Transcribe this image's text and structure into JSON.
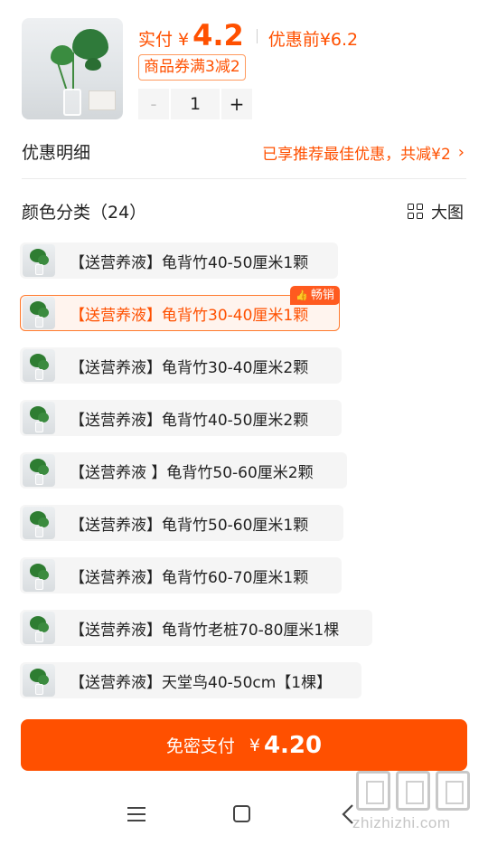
{
  "product": {
    "price_label": "实付",
    "currency": "¥",
    "price_value": "4.2",
    "original_label": "优惠前",
    "original_value": "¥6.2",
    "coupon": "商品券满3减2",
    "quantity": "1",
    "minus_symbol": "-",
    "plus_symbol": "+"
  },
  "discount": {
    "title": "优惠明细",
    "info": "已享推荐最佳优惠，共减¥2"
  },
  "variants": {
    "title": "颜色分类（24）",
    "big_view_label": "大图",
    "hot_badge": "畅销",
    "selected_index": 1,
    "items": [
      {
        "label": "【送营养液】龟背竹40-50厘米1颗"
      },
      {
        "label": "【送营养液】龟背竹30-40厘米1颗"
      },
      {
        "label": "【送营养液】龟背竹30-40厘米2颗"
      },
      {
        "label": "【送营养液】龟背竹40-50厘米2颗"
      },
      {
        "label": "【送营养液 】龟背竹50-60厘米2颗"
      },
      {
        "label": "【送营养液】龟背竹50-60厘米1颗"
      },
      {
        "label": "【送营养液】龟背竹60-70厘米1颗"
      },
      {
        "label": "【送营养液】龟背竹老桩70-80厘米1棵"
      },
      {
        "label": "【送营养液】天堂鸟40-50cm【1棵】"
      }
    ]
  },
  "pay": {
    "label": "免密支付",
    "currency": "¥",
    "amount": "4.20"
  },
  "watermark": {
    "text": "zhizhizhi.com"
  },
  "colors": {
    "accent": "#ff5000",
    "badge": "#ff5a1f",
    "selected_bg": "#fff4ee",
    "chip_bg": "#f5f5f5"
  }
}
